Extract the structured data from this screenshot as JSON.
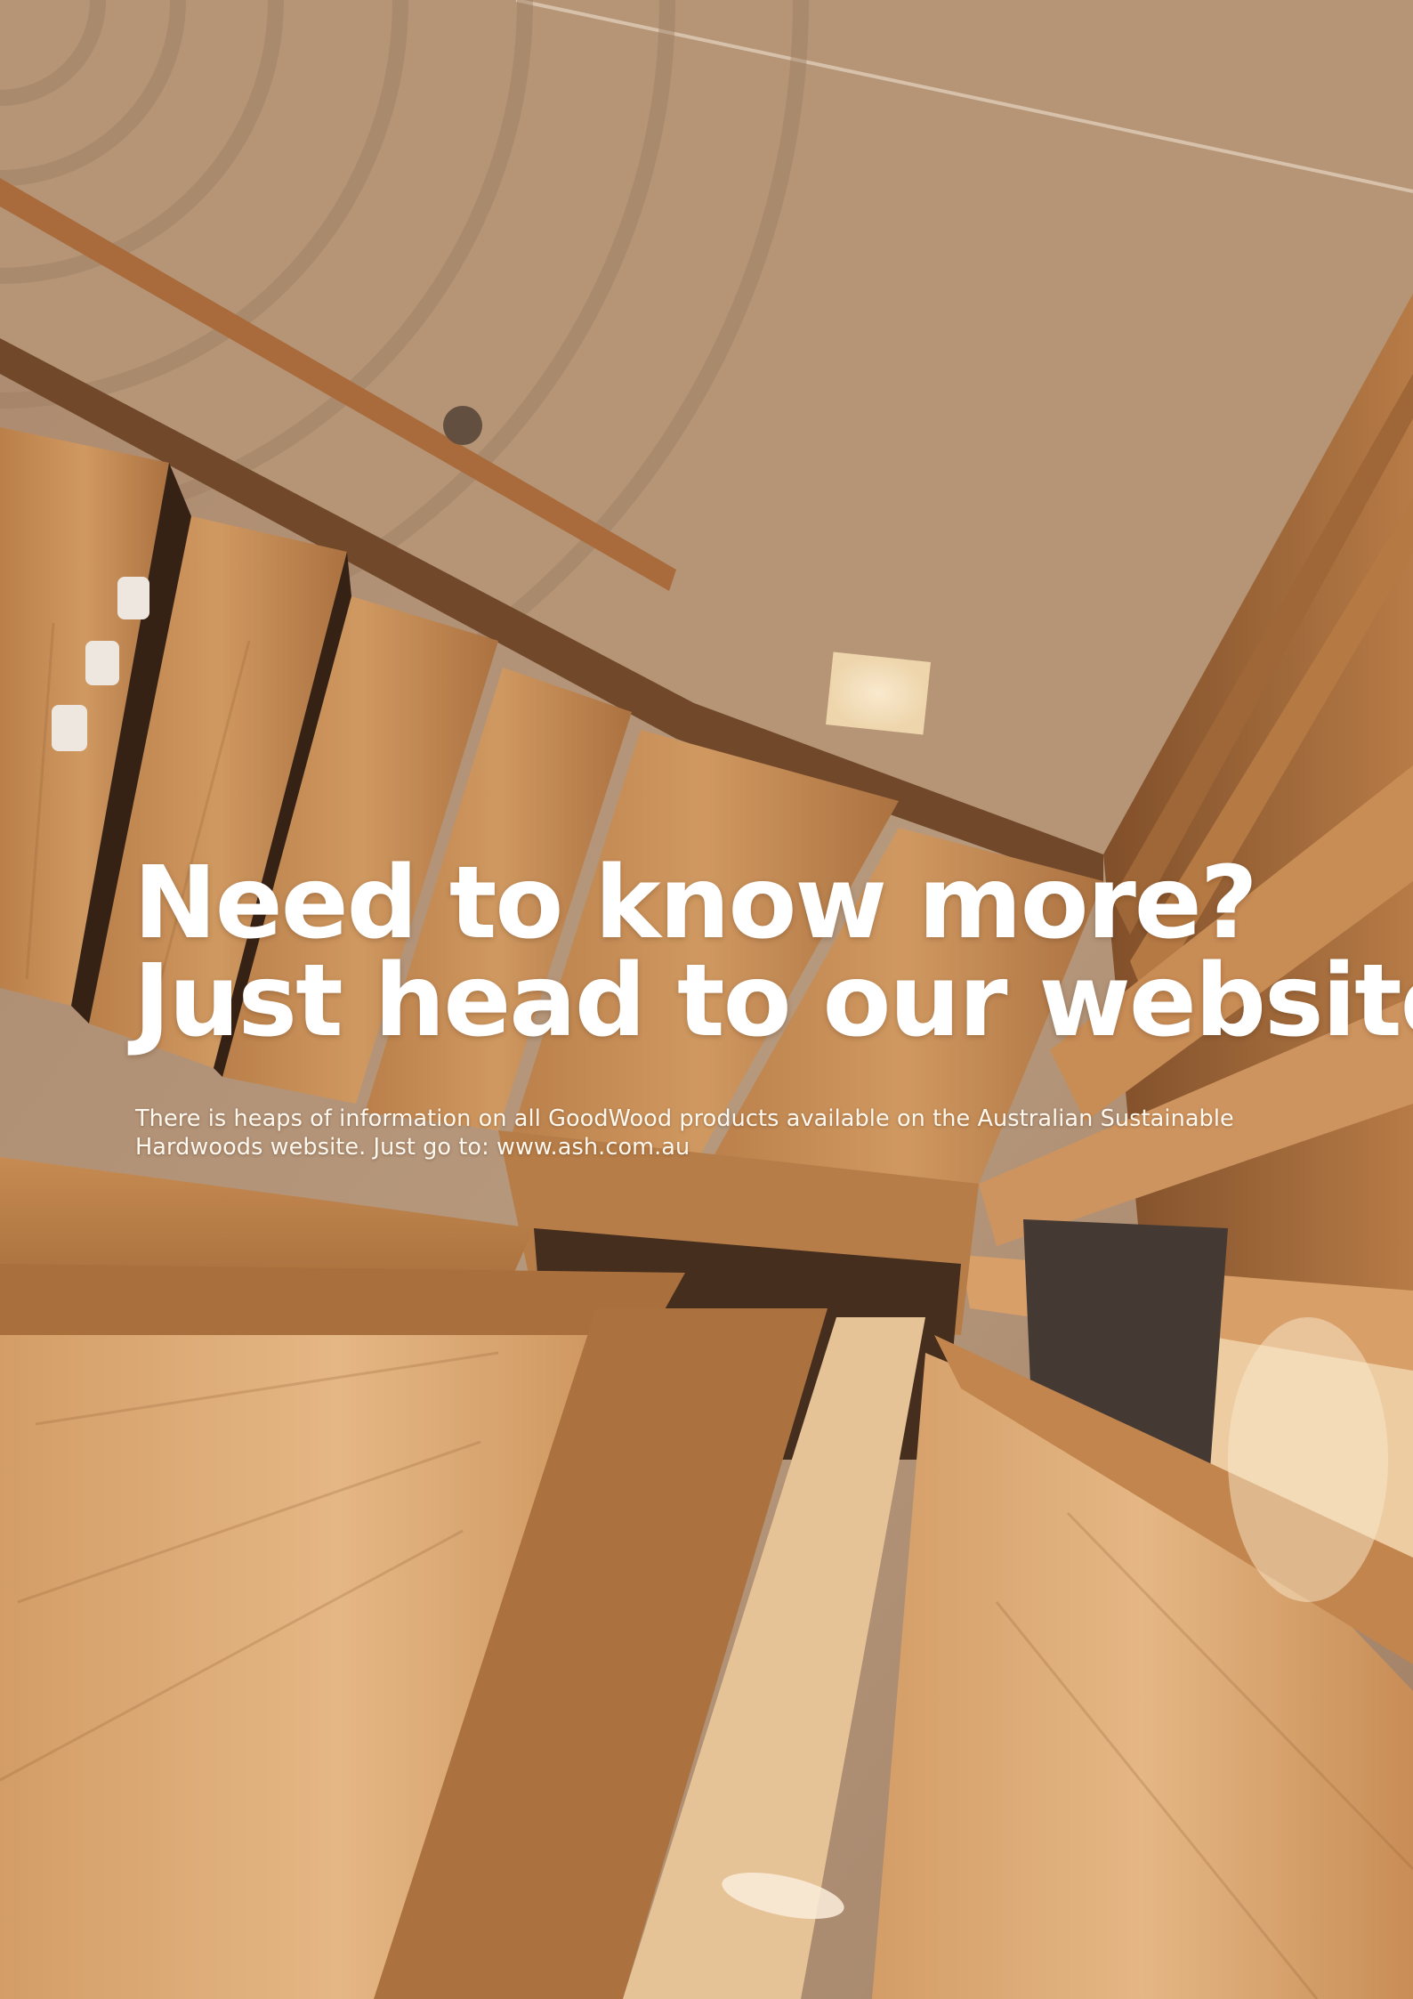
{
  "page": {
    "headline_line1": "Need to know more?",
    "headline_line2": "Just head to our website!",
    "body_line1": "There is heaps of information on all GoodWood products available on the Australian Sustainable",
    "body_line2": "Hardwoods website. Just go to: www.ash.com.au"
  },
  "colors": {
    "text": "#ffffff",
    "timber": "#c28a55",
    "ceiling": "#b89878"
  }
}
